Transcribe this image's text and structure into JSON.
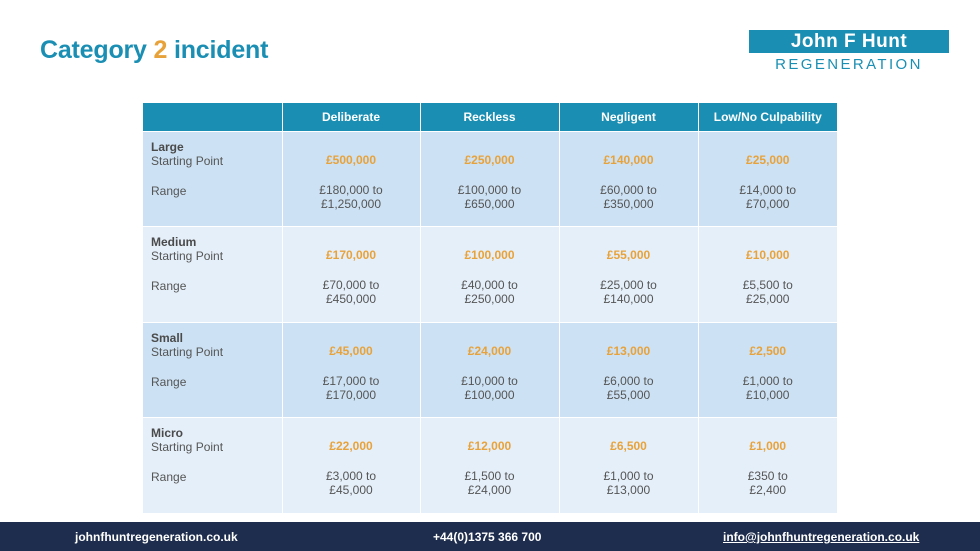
{
  "title": {
    "prefix": "Category ",
    "number": "2",
    "suffix": " incident"
  },
  "logo": {
    "top": "John F Hunt",
    "bottom": "REGENERATION"
  },
  "table": {
    "headers": [
      "",
      "Deliberate",
      "Reckless",
      "Negligent",
      "Low/No Culpability"
    ],
    "rows": [
      {
        "name": "Large",
        "start_label": "Starting Point",
        "range_label": "Range",
        "cells": [
          {
            "start": "£500,000",
            "range1": "£180,000 to",
            "range2": "£1,250,000"
          },
          {
            "start": "£250,000",
            "range1": "£100,000 to",
            "range2": "£650,000"
          },
          {
            "start": "£140,000",
            "range1": "£60,000 to",
            "range2": "£350,000"
          },
          {
            "start": "£25,000",
            "range1": "£14,000 to",
            "range2": "£70,000"
          }
        ]
      },
      {
        "name": "Medium",
        "start_label": "Starting Point",
        "range_label": "Range",
        "cells": [
          {
            "start": "£170,000",
            "range1": "£70,000 to",
            "range2": "£450,000"
          },
          {
            "start": "£100,000",
            "range1": "£40,000 to",
            "range2": "£250,000"
          },
          {
            "start": "£55,000",
            "range1": "£25,000 to",
            "range2": "£140,000"
          },
          {
            "start": "£10,000",
            "range1": "£5,500 to",
            "range2": "£25,000"
          }
        ]
      },
      {
        "name": "Small",
        "start_label": "Starting Point",
        "range_label": "Range",
        "cells": [
          {
            "start": "£45,000",
            "range1": "£17,000 to",
            "range2": "£170,000"
          },
          {
            "start": "£24,000",
            "range1": "£10,000 to",
            "range2": "£100,000"
          },
          {
            "start": "£13,000",
            "range1": "£6,000 to",
            "range2": "£55,000"
          },
          {
            "start": "£2,500",
            "range1": "£1,000 to",
            "range2": "£10,000"
          }
        ]
      },
      {
        "name": "Micro",
        "start_label": "Starting Point",
        "range_label": "Range",
        "cells": [
          {
            "start": "£22,000",
            "range1": "£3,000 to",
            "range2": "£45,000"
          },
          {
            "start": "£12,000",
            "range1": "£1,500 to",
            "range2": "£24,000"
          },
          {
            "start": "£6,500",
            "range1": "£1,000 to",
            "range2": "£13,000"
          },
          {
            "start": "£1,000",
            "range1": "£350 to",
            "range2": "£2,400"
          }
        ]
      }
    ]
  },
  "footer": {
    "website": "johnfhuntregeneration.co.uk",
    "phone": "+44(0)1375 366 700",
    "email": "info@johnfhuntregeneration.co.uk"
  },
  "colors": {
    "brand": "#1a8fb3",
    "accent": "#e8a23a",
    "footer": "#1e2d4d",
    "row_dark": "#cce1f3",
    "row_light": "#e5eff9"
  }
}
